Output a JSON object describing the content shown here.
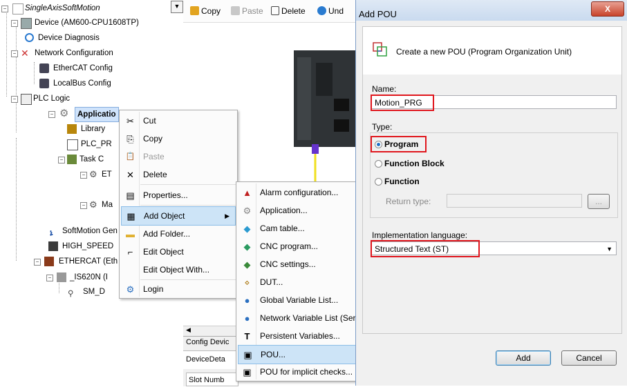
{
  "tree": {
    "dropdown_glyph": "▼",
    "items": [
      {
        "label": "SingleAxisSoftMotion",
        "icon": "project-icon"
      },
      {
        "label": "Device (AM600-CPU1608TP)",
        "icon": "device-icon"
      },
      {
        "label": "Device Diagnosis",
        "icon": "diagnosis-icon"
      },
      {
        "label": "Network Configuration",
        "icon": "network-icon"
      },
      {
        "label": "EtherCAT Config",
        "icon": "config-icon"
      },
      {
        "label": "LocalBus Config",
        "icon": "config-icon"
      },
      {
        "label": "PLC Logic",
        "icon": "plc-icon"
      },
      {
        "label": "Applicatio",
        "icon": "gear-icon"
      },
      {
        "label": "Library",
        "icon": "library-icon"
      },
      {
        "label": "PLC_PR",
        "icon": "program-icon"
      },
      {
        "label": "Task C",
        "icon": "task-icon"
      },
      {
        "label": "ET",
        "icon": "task-icon"
      },
      {
        "label": "Ma",
        "icon": "task-icon"
      },
      {
        "label": "SoftMotion Gen",
        "icon": "softmotion-icon"
      },
      {
        "label": "HIGH_SPEED",
        "icon": "io-icon"
      },
      {
        "label": "ETHERCAT (Eth",
        "icon": "ethercat-icon"
      },
      {
        "label": "_IS620N (I",
        "icon": "drive-icon"
      },
      {
        "label": "SM_D",
        "icon": "axis-icon"
      }
    ]
  },
  "toolbar": {
    "copy": "Copy",
    "paste": "Paste",
    "delete": "Delete",
    "undo": "Und"
  },
  "context_menu": {
    "items": [
      {
        "label": "Cut",
        "icon": "cut-icon",
        "glyph": "✂"
      },
      {
        "label": "Copy",
        "icon": "copy-icon",
        "glyph": "⎘"
      },
      {
        "label": "Paste",
        "icon": "paste-icon",
        "glyph": "📋",
        "disabled": true
      },
      {
        "label": "Delete",
        "icon": "delete-icon",
        "glyph": "✕"
      },
      {
        "label": "Properties...",
        "icon": "properties-icon",
        "glyph": "▤"
      },
      {
        "label": "Add Object",
        "icon": "add-object-icon",
        "glyph": "▦",
        "submenu_arrow": "▶"
      },
      {
        "label": "Add Folder...",
        "icon": "folder-icon",
        "glyph": "▬"
      },
      {
        "label": "Edit Object",
        "icon": "edit-icon",
        "glyph": "⌐"
      },
      {
        "label": "Edit Object With...",
        "icon": "",
        "glyph": ""
      },
      {
        "label": "Login",
        "icon": "login-icon",
        "glyph": "⚙"
      }
    ]
  },
  "submenu": {
    "items": [
      {
        "label": "Alarm configuration...",
        "icon": "alarm-icon",
        "glyph": "▲"
      },
      {
        "label": "Application...",
        "icon": "application-icon",
        "glyph": "⚙"
      },
      {
        "label": "Cam table...",
        "icon": "cam-table-icon",
        "glyph": "◆"
      },
      {
        "label": "CNC program...",
        "icon": "cnc-program-icon",
        "glyph": "◆"
      },
      {
        "label": "CNC settings...",
        "icon": "cnc-settings-icon",
        "glyph": "◆"
      },
      {
        "label": "DUT...",
        "icon": "dut-icon",
        "glyph": "⋄"
      },
      {
        "label": "Global Variable List...",
        "icon": "gvl-icon",
        "glyph": "●"
      },
      {
        "label": "Network Variable List (Ser",
        "icon": "nvl-icon",
        "glyph": "●"
      },
      {
        "label": "Persistent Variables...",
        "icon": "persistent-icon",
        "glyph": "T"
      },
      {
        "label": "POU...",
        "icon": "pou-icon",
        "glyph": "▣"
      },
      {
        "label": "POU for implicit checks...",
        "icon": "pou-checks-icon",
        "glyph": "▣"
      }
    ]
  },
  "bottom_panel": {
    "tab": "Config Devic",
    "device_detail": "DeviceDeta",
    "slot": "Slot Numb"
  },
  "dialog": {
    "title": "Add POU",
    "close_glyph": "X",
    "header_text": "Create a new POU (Program Organization Unit)",
    "name_label": "Name:",
    "name_value": "Motion_PRG",
    "type_label": "Type:",
    "types": [
      {
        "label": "Program",
        "selected": true
      },
      {
        "label": "Function Block",
        "selected": false
      },
      {
        "label": "Function",
        "selected": false
      }
    ],
    "return_type_label": "Return type:",
    "return_type_value": "",
    "browse_glyph": "...",
    "impl_label": "Implementation language:",
    "impl_value": "Structured Text (ST)",
    "add_button": "Add",
    "cancel_button": "Cancel"
  },
  "colors": {
    "highlight_red": "#e0151c",
    "selection_blue": "#cde4f7",
    "title_gradient": "#c9daef"
  }
}
